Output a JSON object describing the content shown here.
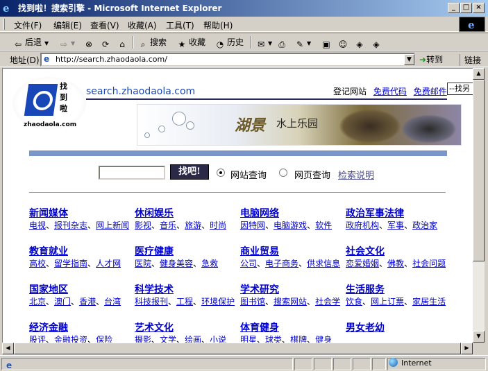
{
  "window": {
    "title": "找到啦！搜索引擎 - Microsoft Internet Explorer"
  },
  "menu": [
    "文件(F)",
    "编辑(E)",
    "查看(V)",
    "收藏(A)",
    "工具(T)",
    "帮助(H)"
  ],
  "toolbar": {
    "back": "后退",
    "search": "搜索",
    "favorites": "收藏",
    "history": "历史"
  },
  "address": {
    "label": "地址(D)",
    "url": "http://search.zhaodaola.com/",
    "go": "转到",
    "links": "链接"
  },
  "status": {
    "zone": "Internet"
  },
  "page": {
    "logo_chars": "找到啦",
    "logo_domain": "zhaodaola.com",
    "site_url": "search.zhaodaola.com",
    "toplinks": [
      "登记网站",
      "免费代码",
      "免费邮件"
    ],
    "find_select": "--找另",
    "banner": {
      "title": "湖景",
      "subtitle": "水上乐园"
    },
    "search_button": "找吧!",
    "radio_site": "网站查询",
    "radio_web": "网页查询",
    "help": "检索说明",
    "categories": [
      {
        "title": "新闻媒体",
        "subs": [
          "电视",
          "报刊杂志",
          "网上新闻"
        ]
      },
      {
        "title": "休闲娱乐",
        "subs": [
          "影视",
          "音乐",
          "旅游",
          "时尚"
        ]
      },
      {
        "title": "电脑网络",
        "subs": [
          "因特网",
          "电脑游戏",
          "软件"
        ]
      },
      {
        "title": "政治军事法律",
        "subs": [
          "政府机构",
          "军事",
          "政治家"
        ]
      },
      {
        "title": "教育就业",
        "subs": [
          "高校",
          "留学指南",
          "人才网"
        ]
      },
      {
        "title": "医疗健康",
        "subs": [
          "医院",
          "健身美容",
          "急救"
        ]
      },
      {
        "title": "商业贸易",
        "subs": [
          "公司",
          "电子商务",
          "供求信息"
        ]
      },
      {
        "title": "社会文化",
        "subs": [
          "恋爱婚姻",
          "佛教",
          "社会问题"
        ]
      },
      {
        "title": "国家地区",
        "subs": [
          "北京",
          "澳门",
          "香港",
          "台湾"
        ]
      },
      {
        "title": "科学技术",
        "subs": [
          "科技报刊",
          "工程",
          "环境保护"
        ]
      },
      {
        "title": "学术研究",
        "subs": [
          "图书馆",
          "搜索网站",
          "社会学"
        ]
      },
      {
        "title": "生活服务",
        "subs": [
          "饮食",
          "网上订票",
          "家居生活"
        ]
      },
      {
        "title": "经济金融",
        "subs": [
          "股评",
          "金融投资",
          "保险"
        ]
      },
      {
        "title": "艺术文化",
        "subs": [
          "摄影",
          "文学",
          "绘画",
          "小说"
        ]
      },
      {
        "title": "体育健身",
        "subs": [
          "明星",
          "球类",
          "棋牌",
          "健身"
        ]
      },
      {
        "title": "男女老幼",
        "subs": []
      }
    ]
  }
}
